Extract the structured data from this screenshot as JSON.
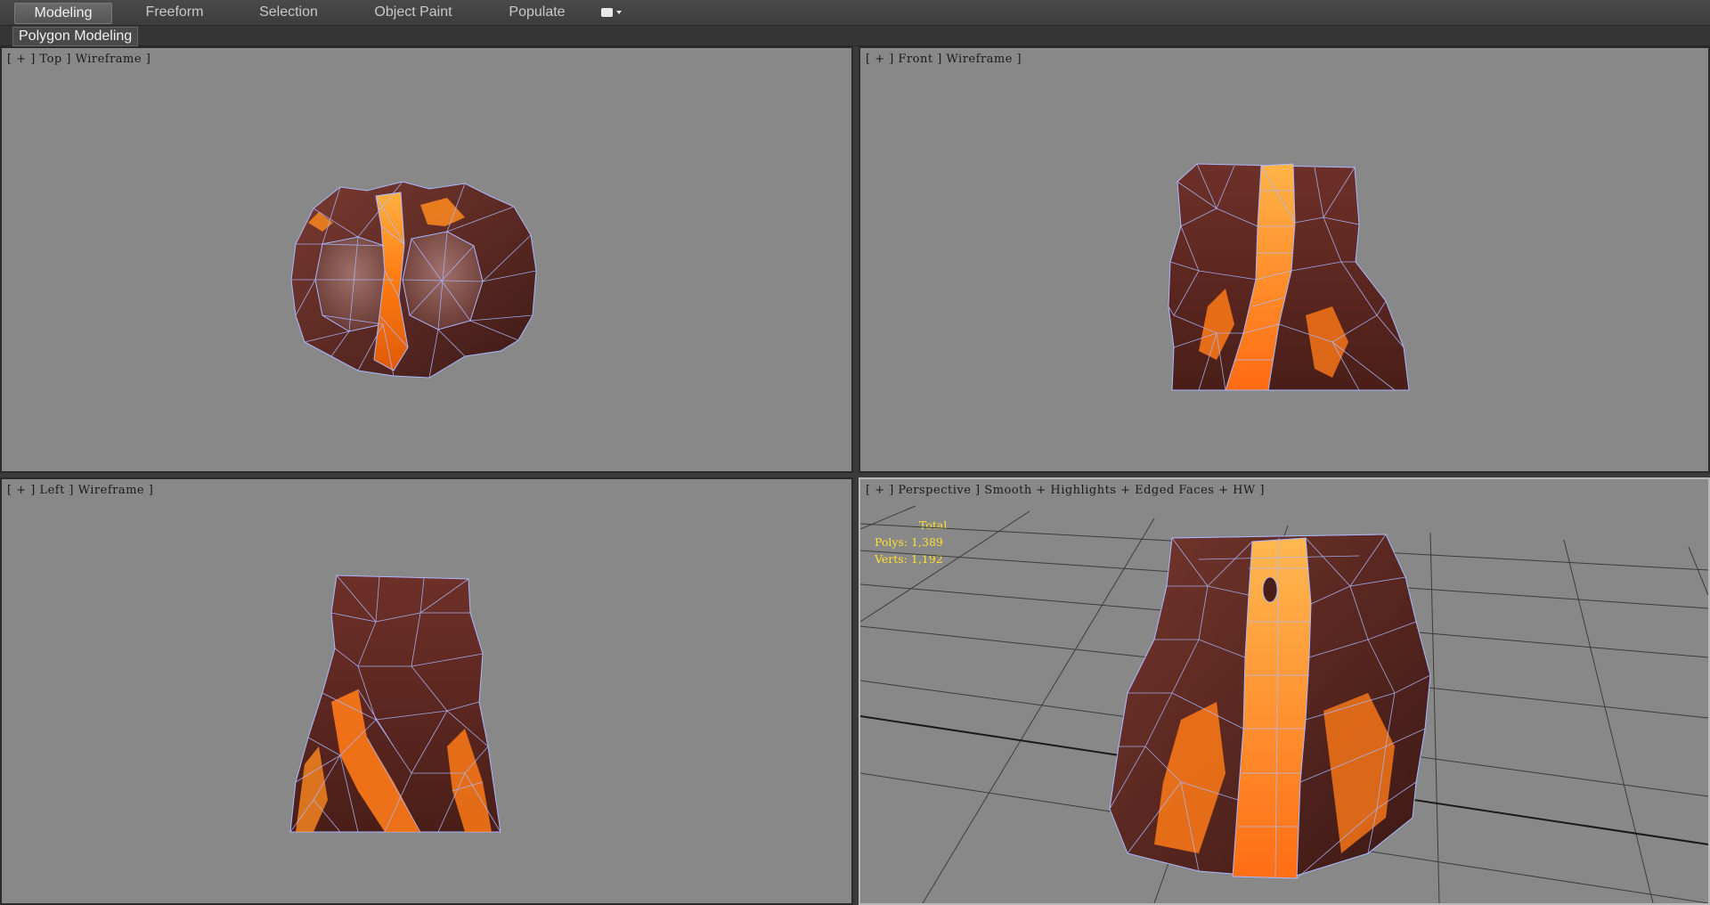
{
  "ribbon": {
    "tabs": [
      {
        "label": "Modeling",
        "active": true
      },
      {
        "label": "Freeform",
        "active": false
      },
      {
        "label": "Selection",
        "active": false
      },
      {
        "label": "Object Paint",
        "active": false
      },
      {
        "label": "Populate",
        "active": false
      }
    ],
    "dropdown_icon": "ribbon-options-icon",
    "panel_label": "Polygon Modeling"
  },
  "viewports": {
    "top": {
      "label": "[ + ] Top ] Wireframe ]"
    },
    "front": {
      "label": "[ + ] Front ] Wireframe ]"
    },
    "left": {
      "label": "[ + ] Left ] Wireframe ]"
    },
    "perspective": {
      "label": "[ + ] Perspective ] Smooth + Highlights + Edged Faces + HW ]"
    }
  },
  "stats": {
    "title": "Total",
    "polys": "Polys: 1,389",
    "verts": "Verts: 1,192"
  },
  "colors": {
    "viewport_bg": "#888888",
    "rock": "#5e2a22",
    "lava": "#ff8a1e",
    "wire": "#aab8ff",
    "stats_text": "#ffe033"
  }
}
